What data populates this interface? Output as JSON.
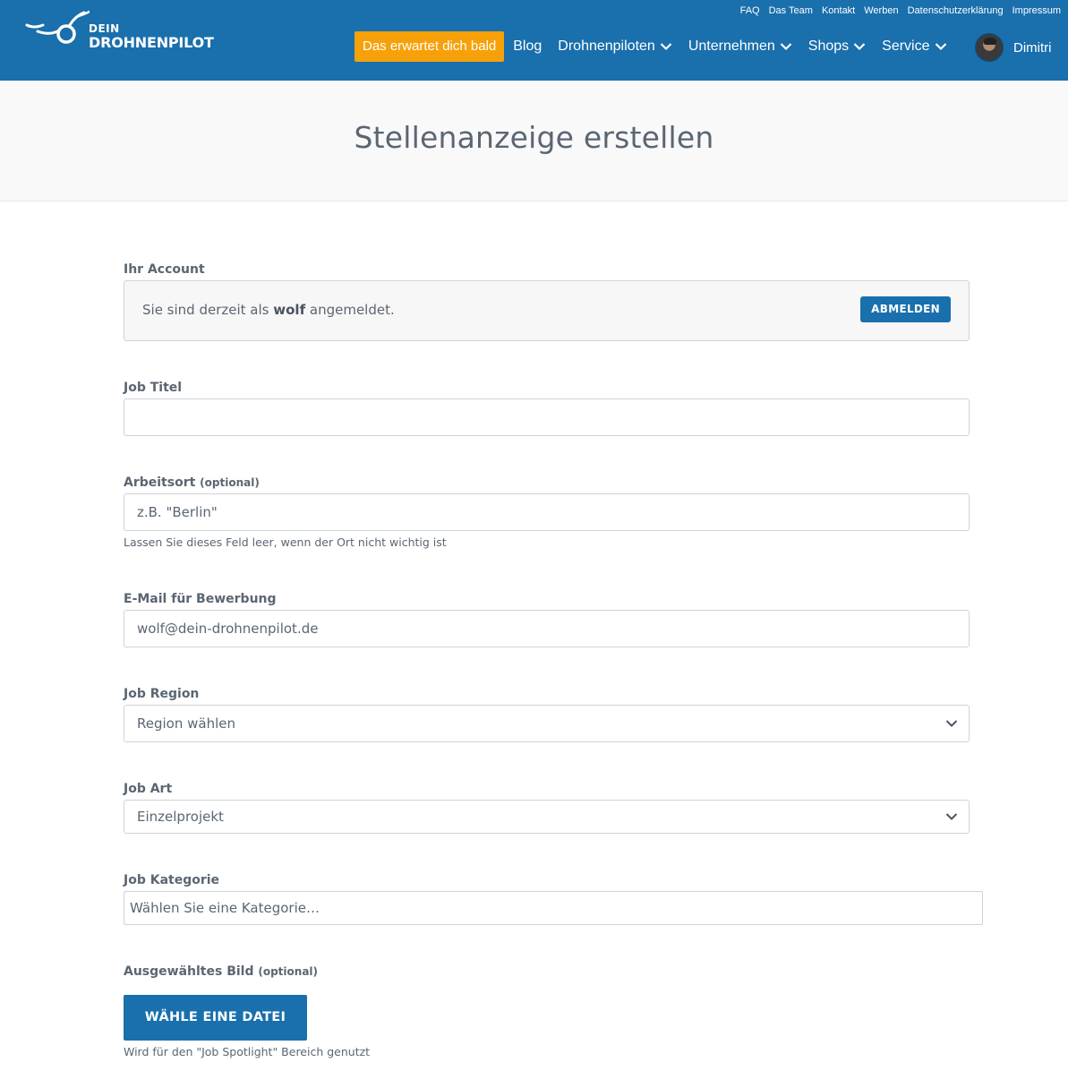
{
  "brand": {
    "line1": "DEIN",
    "line2": "DROHNENPILOT"
  },
  "top_links": [
    "FAQ",
    "Das Team",
    "Kontakt",
    "Werben",
    "Datenschutzerklärung",
    "Impressum"
  ],
  "main_nav": {
    "cta": "Das erwartet dich bald",
    "items": [
      {
        "label": "Blog",
        "dropdown": false
      },
      {
        "label": "Drohnenpiloten",
        "dropdown": true
      },
      {
        "label": "Unternehmen",
        "dropdown": true
      },
      {
        "label": "Shops",
        "dropdown": true
      },
      {
        "label": "Service",
        "dropdown": true
      }
    ],
    "user_name": "Dimitri"
  },
  "page": {
    "title": "Stellenanzeige erstellen"
  },
  "form": {
    "account": {
      "label": "Ihr Account",
      "text_before": "Sie sind derzeit als",
      "username": "wolf",
      "text_after": "angemeldet.",
      "logout_label": "ABMELDEN"
    },
    "job_title": {
      "label": "Job Titel",
      "value": ""
    },
    "location": {
      "label": "Arbeitsort",
      "optional": "(optional)",
      "placeholder": "z.B. \"Berlin\"",
      "hint": "Lassen Sie dieses Feld leer, wenn der Ort nicht wichtig ist"
    },
    "email": {
      "label": "E-Mail für Bewerbung",
      "value": "wolf@dein-drohnenpilot.de"
    },
    "region": {
      "label": "Job Region",
      "selected": "Region wählen"
    },
    "job_type": {
      "label": "Job Art",
      "selected": "Einzelprojekt"
    },
    "category": {
      "label": "Job Kategorie",
      "placeholder": "Wählen Sie eine Kategorie…"
    },
    "image": {
      "label": "Ausgewähltes Bild",
      "optional": "(optional)",
      "button_label": "WÄHLE EINE DATEI",
      "hint": "Wird für den \"Job Spotlight\" Bereich genutzt"
    }
  },
  "colors": {
    "primary": "#1a6fad",
    "accent": "#f7a10a",
    "text": "#5b6673"
  }
}
